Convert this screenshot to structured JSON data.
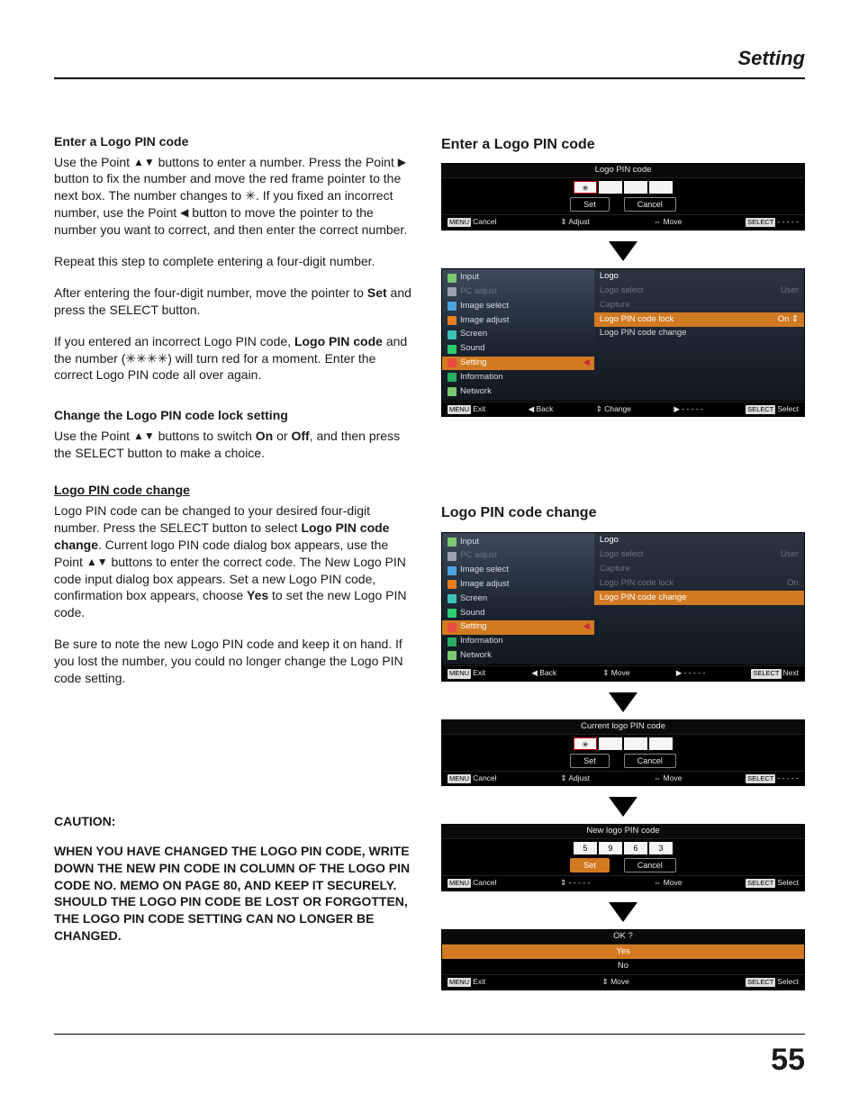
{
  "page": {
    "header": "Setting",
    "number": "55"
  },
  "left": {
    "h1": "Enter a Logo PIN code",
    "p1a": "Use the Point ",
    "p1b": " buttons to enter a number. Press the Point ",
    "p1c": " button to fix the number and move the red frame pointer to the next box. The number changes to ✳. If you fixed an incorrect number, use the Point ",
    "p1d": " button to move the pointer to the number you want to correct, and then enter the correct number.",
    "p2": "Repeat this step to complete entering a four-digit number.",
    "p3a": "After entering the four-digit number, move the pointer to ",
    "p3b": "Set",
    "p3c": " and press the SELECT button.",
    "p4a": "If you entered an incorrect Logo PIN code, ",
    "p4b": "Logo PIN code",
    "p4c": " and the number (✳✳✳✳) will turn red for a moment. Enter the correct Logo PIN code all over again.",
    "h2": "Change the Logo PIN code lock setting",
    "p5a": "Use the Point ",
    "p5b": " buttons to switch ",
    "p5c": "On",
    "p5d": " or ",
    "p5e": "Off",
    "p5f": ", and then press the SELECT button to make a choice.",
    "h3": "Logo PIN code change",
    "p6a": "Logo PIN code can be changed to your desired four-digit number. Press the SELECT button to select ",
    "p6b": "Logo PIN code change",
    "p6c": ". Current logo PIN code dialog box appears, use the Point ",
    "p6d": " buttons to enter the correct code. The New Logo PIN code input dialog box appears. Set a new Logo PIN code, confirmation box appears, choose ",
    "p6e": "Yes",
    "p6f": " to set the new Logo PIN code.",
    "p7": "Be sure to note the new Logo PIN code and keep it on hand. If you lost the number, you could no longer change the Logo PIN code setting.",
    "caution_h": "CAUTION:",
    "caution_body": "WHEN YOU HAVE CHANGED THE LOGO PIN CODE, WRITE DOWN THE NEW PIN CODE IN COLUMN OF THE LOGO PIN CODE NO. MEMO ON PAGE 80, AND KEEP IT SECURELY. SHOULD THE LOGO PIN CODE BE LOST OR FORGOTTEN, THE LOGO PIN CODE SETTING CAN NO LONGER BE CHANGED."
  },
  "figA": {
    "title": "Enter a Logo PIN code",
    "dlg_title": "Logo PIN code",
    "set": "Set",
    "cancel": "Cancel",
    "hints": {
      "cancel": "Cancel",
      "adjust": "Adjust",
      "move": "Move",
      "sel": "- - - - -"
    }
  },
  "menu": {
    "items": [
      {
        "label": "Input",
        "dim": false
      },
      {
        "label": "PC adjust",
        "dim": true
      },
      {
        "label": "Image select",
        "dim": false
      },
      {
        "label": "Image adjust",
        "dim": false
      },
      {
        "label": "Screen",
        "dim": false
      },
      {
        "label": "Sound",
        "dim": false
      },
      {
        "label": "Setting",
        "dim": false,
        "hl": true
      },
      {
        "label": "Information",
        "dim": false
      },
      {
        "label": "Network",
        "dim": false
      }
    ],
    "rightA": {
      "header": "Logo",
      "rows": [
        {
          "l": "Logo select",
          "r": "User",
          "dim": true
        },
        {
          "l": "Capture",
          "r": "",
          "dim": true
        },
        {
          "l": "Logo PIN code lock",
          "r": "On ⇕",
          "hl": true
        },
        {
          "l": "Logo PIN code change",
          "r": ""
        }
      ]
    },
    "hintsA": {
      "exit": "Exit",
      "back": "Back",
      "change": "Change",
      "fwd": "- - - - -",
      "sel": "Select"
    },
    "rightB": {
      "header": "Logo",
      "rows": [
        {
          "l": "Logo select",
          "r": "User",
          "dim": true
        },
        {
          "l": "Capture",
          "r": "",
          "dim": true
        },
        {
          "l": "Logo PIN code lock",
          "r": "On",
          "dim": true
        },
        {
          "l": "Logo PIN code change",
          "r": "",
          "hl": true
        }
      ]
    },
    "hintsB": {
      "exit": "Exit",
      "back": "Back",
      "move": "Move",
      "fwd": "- - - - -",
      "sel": "Next"
    }
  },
  "figB": {
    "title": "Logo PIN code change"
  },
  "figC": {
    "title": "Current logo PIN code",
    "pin": [
      "✳",
      "",
      "",
      ""
    ],
    "set": "Set",
    "cancel": "Cancel",
    "hints": {
      "cancel": "Cancel",
      "adjust": "Adjust",
      "move": "Move",
      "sel": "- - - - -"
    }
  },
  "figD": {
    "title": "New logo PIN code",
    "pin": [
      "5",
      "9",
      "6",
      "3"
    ],
    "set": "Set",
    "cancel": "Cancel",
    "hints": {
      "cancel": "Cancel",
      "adjust": "- - - - -",
      "move": "Move",
      "sel": "Select"
    }
  },
  "figE": {
    "title": "OK ?",
    "yes": "Yes",
    "no": "No",
    "hints": {
      "exit": "Exit",
      "move": "Move",
      "sel": "Select"
    }
  },
  "keys": {
    "menu": "MENU",
    "select": "SELECT"
  }
}
